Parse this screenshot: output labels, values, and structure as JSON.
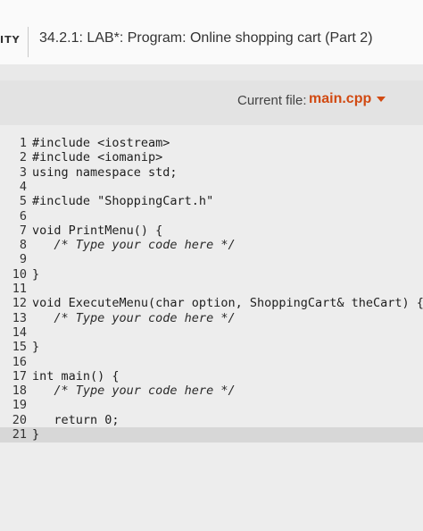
{
  "header": {
    "brand": "ITY",
    "title": "34.2.1: LAB*: Program: Online shopping cart (Part 2)"
  },
  "file_bar": {
    "label": "Current file:",
    "file": "main.cpp"
  },
  "code_lines": [
    {
      "num": "1",
      "text": "#include <iostream>"
    },
    {
      "num": "2",
      "text": "#include <iomanip>"
    },
    {
      "num": "3",
      "text": "using namespace std;"
    },
    {
      "num": "4",
      "text": ""
    },
    {
      "num": "5",
      "text": "#include \"ShoppingCart.h\""
    },
    {
      "num": "6",
      "text": ""
    },
    {
      "num": "7",
      "text": "void PrintMenu() {"
    },
    {
      "num": "8",
      "text": "   /* Type your code here */"
    },
    {
      "num": "9",
      "text": ""
    },
    {
      "num": "10",
      "text": "}"
    },
    {
      "num": "11",
      "text": ""
    },
    {
      "num": "12",
      "text": "void ExecuteMenu(char option, ShoppingCart& theCart) {"
    },
    {
      "num": "13",
      "text": "   /* Type your code here */"
    },
    {
      "num": "14",
      "text": ""
    },
    {
      "num": "15",
      "text": "}"
    },
    {
      "num": "16",
      "text": ""
    },
    {
      "num": "17",
      "text": "int main() {"
    },
    {
      "num": "18",
      "text": "   /* Type your code here */"
    },
    {
      "num": "19",
      "text": ""
    },
    {
      "num": "20",
      "text": "   return 0;"
    },
    {
      "num": "21",
      "text": "}"
    }
  ]
}
